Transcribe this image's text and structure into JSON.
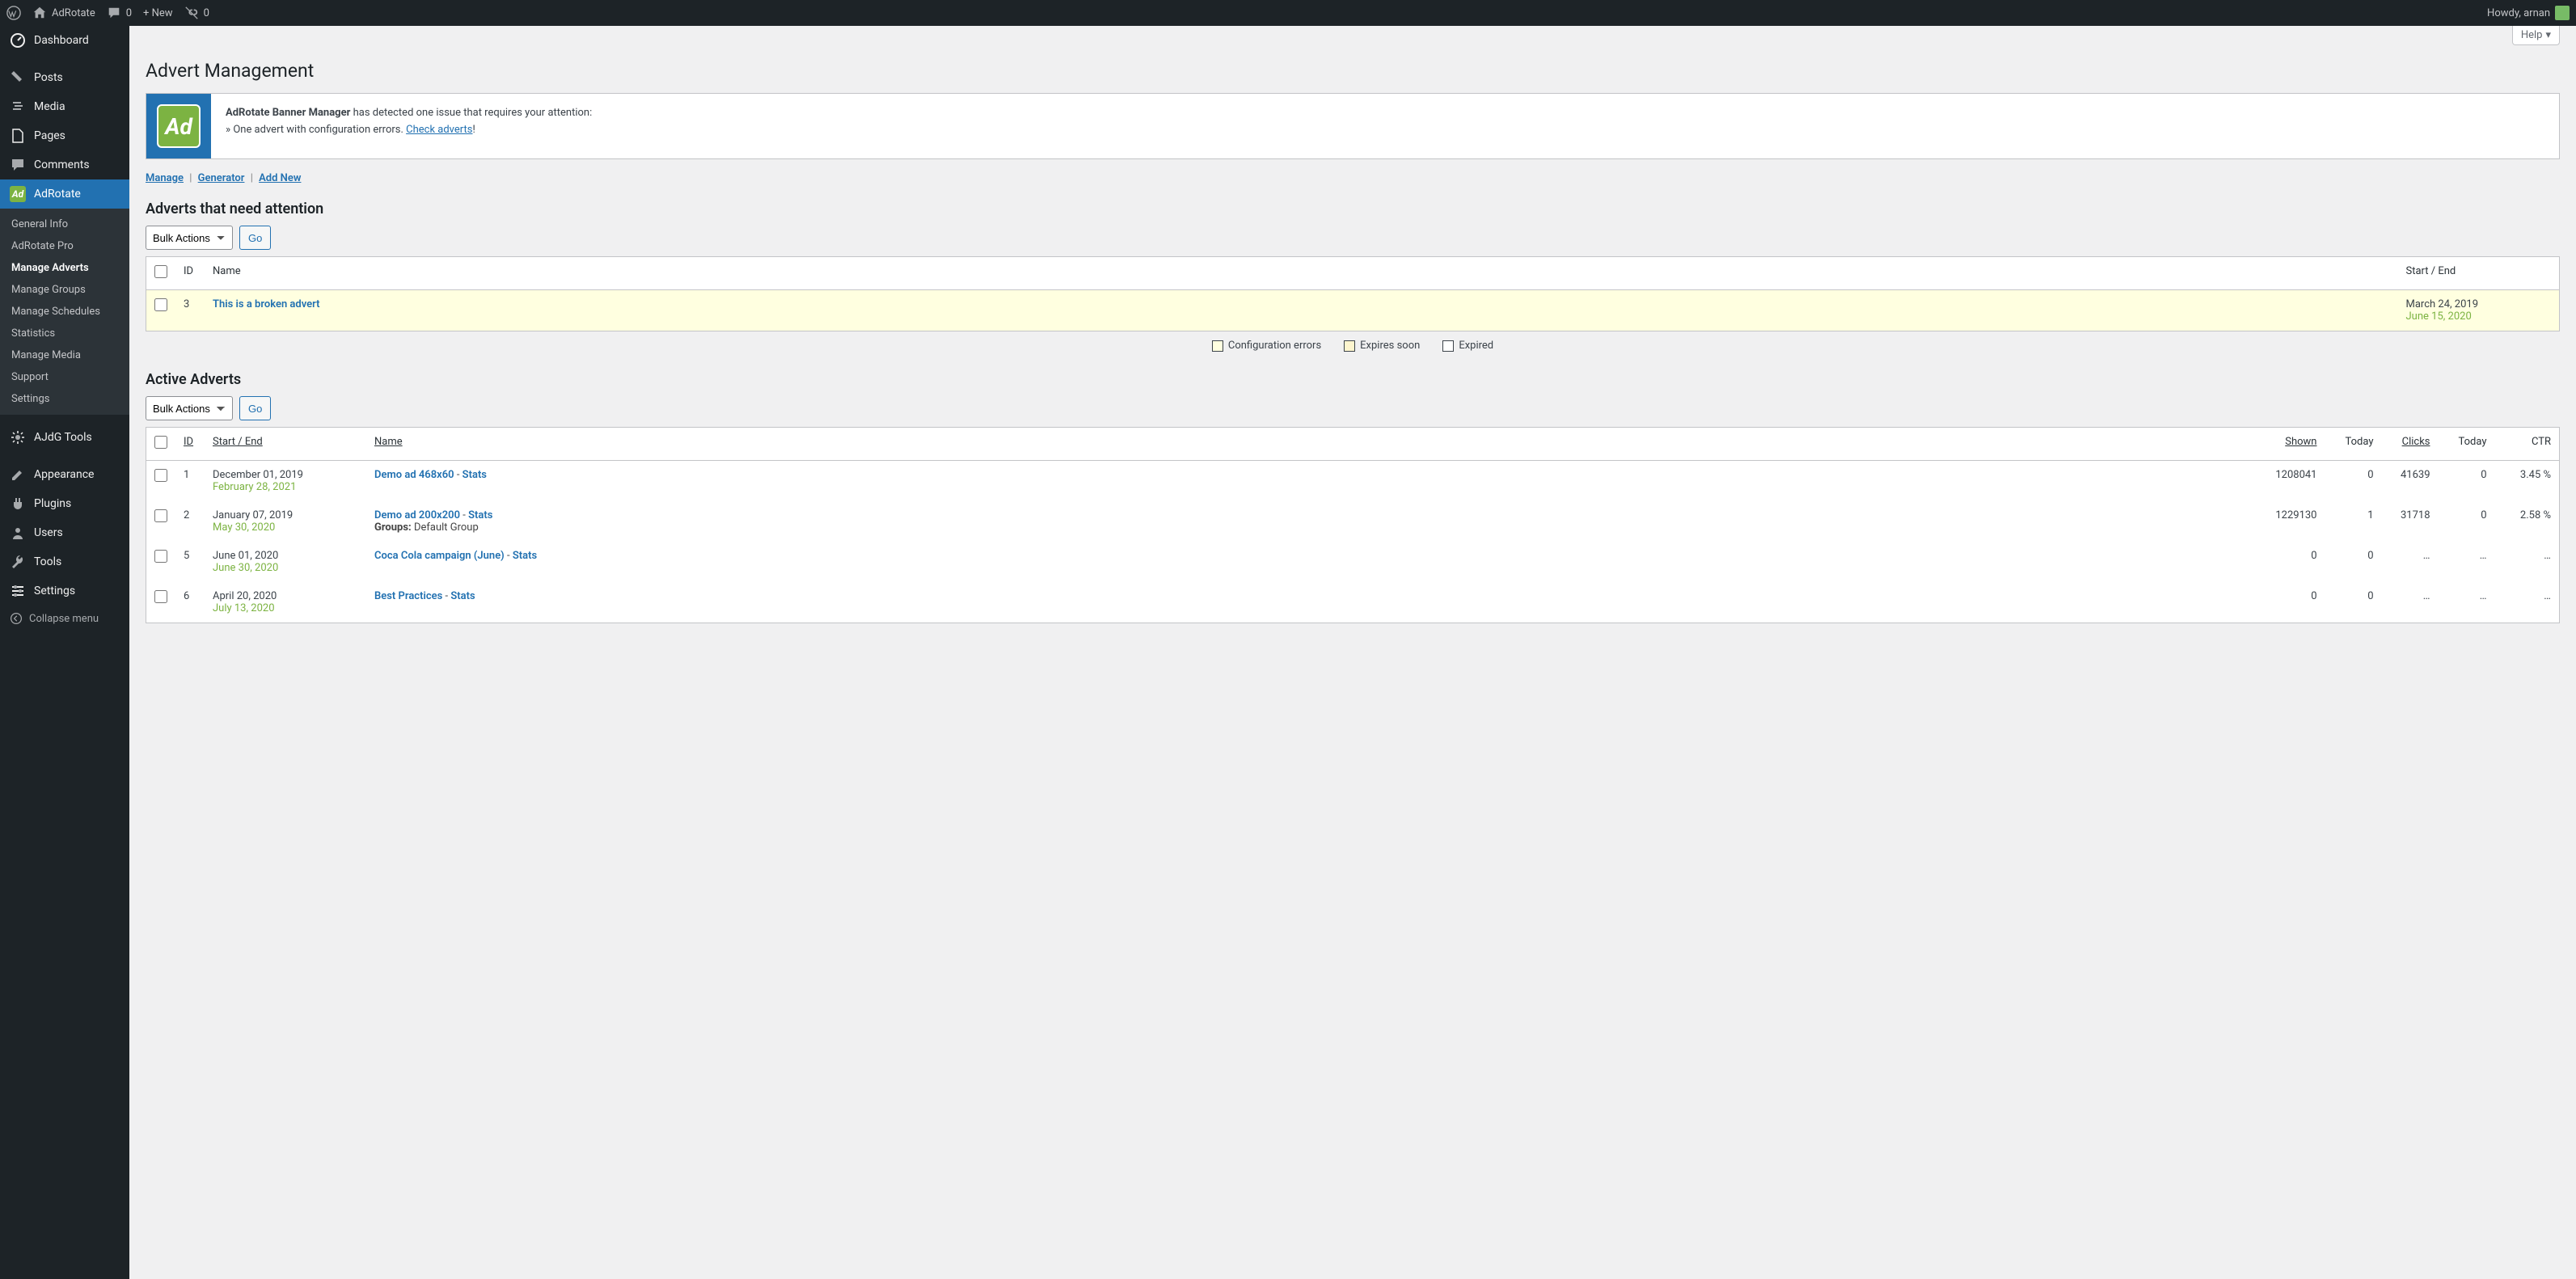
{
  "adminbar": {
    "site": "AdRotate",
    "comments": "0",
    "new": "+ New",
    "broken": "0",
    "howdy": "Howdy, arnan"
  },
  "sidebar": {
    "items": [
      {
        "label": "Dashboard"
      },
      {
        "label": "Posts"
      },
      {
        "label": "Media"
      },
      {
        "label": "Pages"
      },
      {
        "label": "Comments"
      },
      {
        "label": "AdRotate"
      },
      {
        "label": "AJdG Tools"
      },
      {
        "label": "Appearance"
      },
      {
        "label": "Plugins"
      },
      {
        "label": "Users"
      },
      {
        "label": "Tools"
      },
      {
        "label": "Settings"
      }
    ],
    "submenu": [
      "General Info",
      "AdRotate Pro",
      "Manage Adverts",
      "Manage Groups",
      "Manage Schedules",
      "Statistics",
      "Manage Media",
      "Support",
      "Settings"
    ],
    "collapse": "Collapse menu"
  },
  "help": "Help",
  "page_title": "Advert Management",
  "notice": {
    "strong": "AdRotate Banner Manager",
    "line1": " has detected one issue that requires your attention:",
    "line2_prefix": "» One advert with configuration errors. ",
    "link": "Check adverts",
    "suffix": "!"
  },
  "subnav": {
    "manage": "Manage",
    "generator": "Generator",
    "addnew": "Add New"
  },
  "section1": "Adverts that need attention",
  "bulk_label": "Bulk Actions",
  "go": "Go",
  "cols1": {
    "id": "ID",
    "name": "Name",
    "startend": "Start / End"
  },
  "attention_rows": [
    {
      "id": "3",
      "name": "This is a broken advert",
      "start": "March 24, 2019",
      "end": "June 15, 2020"
    }
  ],
  "legend": {
    "conf": "Configuration errors",
    "soon": "Expires soon",
    "exp": "Expired"
  },
  "section2": "Active Adverts",
  "cols2": {
    "id": "ID",
    "startend": "Start / End",
    "name": "Name",
    "shown": "Shown",
    "today1": "Today",
    "clicks": "Clicks",
    "today2": "Today",
    "ctr": "CTR"
  },
  "active_rows": [
    {
      "id": "1",
      "start": "December 01, 2019",
      "end": "February 28, 2021",
      "name": "Demo ad 468x60",
      "stats": "Stats",
      "groups": "",
      "shown": "1208041",
      "today1": "0",
      "clicks": "41639",
      "today2": "0",
      "ctr": "3.45 %"
    },
    {
      "id": "2",
      "start": "January 07, 2019",
      "end": "May 30, 2020",
      "name": "Demo ad 200x200",
      "stats": "Stats",
      "groups": "Default Group",
      "shown": "1229130",
      "today1": "1",
      "clicks": "31718",
      "today2": "0",
      "ctr": "2.58 %"
    },
    {
      "id": "5",
      "start": "June 01, 2020",
      "end": "June 30, 2020",
      "name": "Coca Cola campaign (June)",
      "stats": "Stats",
      "groups": "",
      "shown": "0",
      "today1": "0",
      "clicks": "…",
      "today2": "…",
      "ctr": "…"
    },
    {
      "id": "6",
      "start": "April 20, 2020",
      "end": "July 13, 2020",
      "name": "Best Practices",
      "stats": "Stats",
      "groups": "",
      "shown": "0",
      "today1": "0",
      "clicks": "…",
      "today2": "…",
      "ctr": "…"
    }
  ],
  "groups_label": "Groups:"
}
